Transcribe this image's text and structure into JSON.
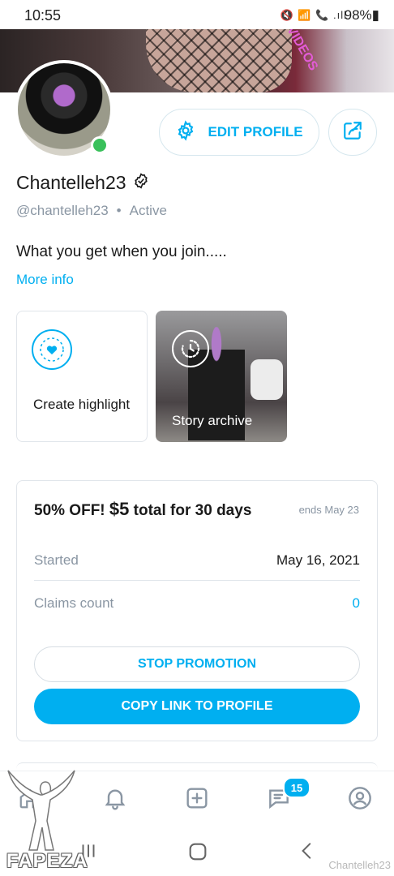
{
  "status_bar": {
    "time": "10:55",
    "icons": "🔇 📶 📞 .ıll",
    "battery": "98%▮"
  },
  "cover": {
    "overlay_text": "R VIDEOS"
  },
  "profile": {
    "display_name": "Chantelleh23",
    "handle": "@chantelleh23",
    "separator": "•",
    "status": "Active",
    "bio": "What you get when you join.....",
    "more_info": "More info",
    "edit_label": "EDIT PROFILE"
  },
  "highlights": {
    "create_label": "Create highlight",
    "story_archive_label": "Story archive"
  },
  "promotion": {
    "title_prefix": "50% OFF!",
    "price": "$5",
    "title_suffix": "total for 30 days",
    "ends": "ends May 23",
    "started_label": "Started",
    "started_value": "May 16, 2021",
    "claims_label": "Claims count",
    "claims_value": "0",
    "stop_label": "STOP PROMOTION",
    "copy_label": "COPY LINK TO PROFILE"
  },
  "bottom_nav": {
    "messages_badge": "15"
  },
  "watermark": {
    "logo_text": "FAPEZA",
    "username": "Chantelleh23"
  },
  "colors": {
    "accent": "#00aff0",
    "muted": "#8a96a3",
    "online": "#39c05a"
  }
}
